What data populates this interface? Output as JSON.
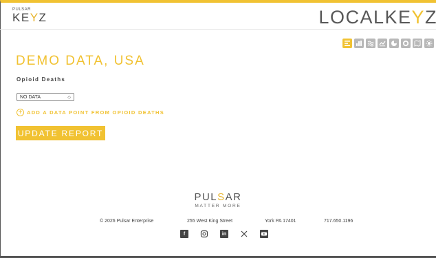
{
  "header": {
    "small_logo_top": "PULSAR",
    "small_logo_main_a": "KE",
    "small_logo_main_y": "Y",
    "small_logo_main_b": "Z",
    "large_logo_a": "LOCALKE",
    "large_logo_y": "Y",
    "large_logo_b": "Z"
  },
  "toolbar": {
    "icons": [
      "report-list-icon",
      "bar-chart-icon",
      "stacked-lines-icon",
      "line-chart-icon",
      "pie-chart-icon",
      "donut-chart-icon",
      "map-icon",
      "settings-icon"
    ],
    "active_color": "#f1c232",
    "inactive_color": "#b8b8b8"
  },
  "main": {
    "title": "DEMO DATA, USA",
    "subtitle": "Opioid Deaths",
    "select_value": "NO DATA",
    "add_link_label": "ADD A DATA POINT FROM OPIOID DEATHS",
    "update_button_label": "UPDATE REPORT"
  },
  "footer": {
    "brand_a": "PUL",
    "brand_s": "S",
    "brand_b": "AR",
    "tagline": "MATTER MORE",
    "copyright": "© 2026 Pulsar Enterprise",
    "street": "255 West King Street",
    "city": "York PA 17401",
    "phone": "717.650.1196",
    "social": [
      "facebook-icon",
      "instagram-icon",
      "linkedin-icon",
      "x-icon",
      "youtube-icon"
    ]
  },
  "colors": {
    "accent": "#f1c232",
    "text": "#444444"
  }
}
